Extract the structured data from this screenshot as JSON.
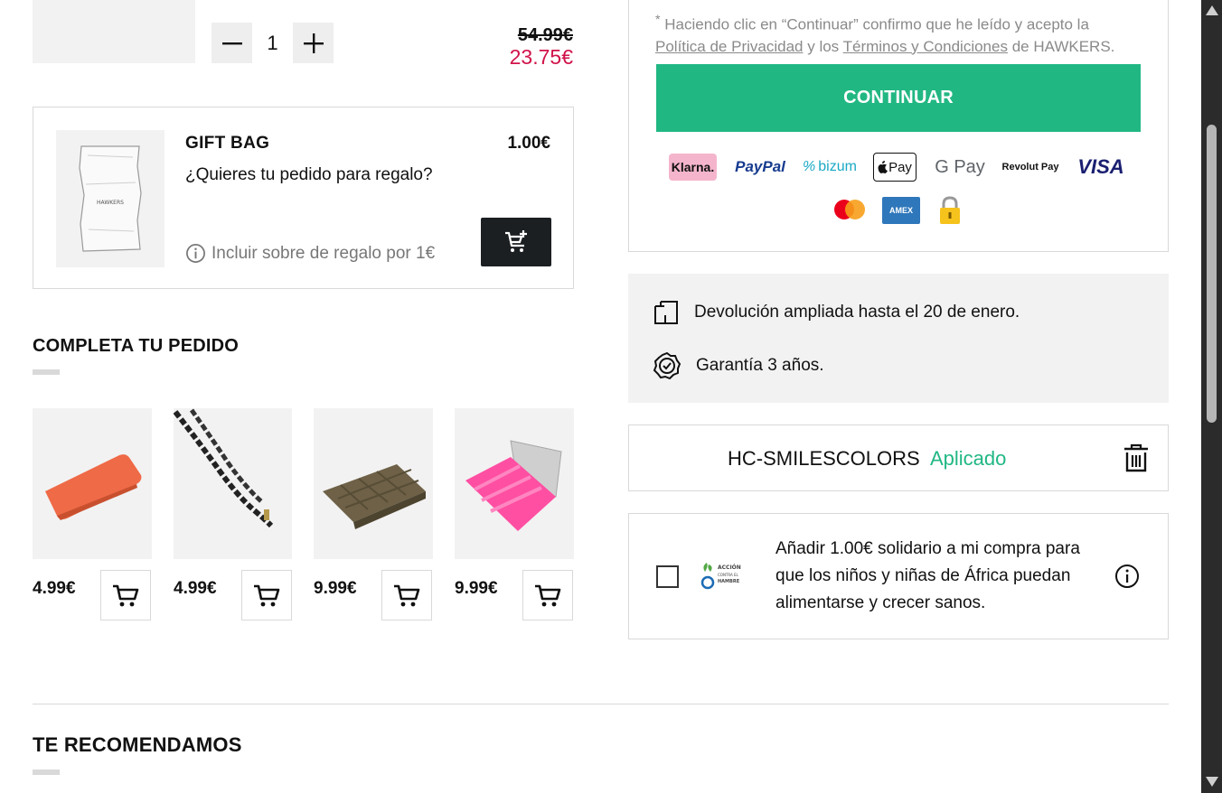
{
  "cart_item": {
    "quantity": "1",
    "old_price": "54.99€",
    "new_price": "23.75€"
  },
  "gift_bag": {
    "title": "GIFT BAG",
    "price": "1.00€",
    "description": "¿Quieres tu pedido para regalo?",
    "note": "Incluir sobre de regalo por 1€",
    "image_brand": "HAWKERS"
  },
  "complete_order": {
    "title": "COMPLETA TU PEDIDO",
    "products": [
      {
        "name": "orange-case",
        "price": "4.99€"
      },
      {
        "name": "black-chain",
        "price": "4.99€"
      },
      {
        "name": "olive-quilted-case",
        "price": "9.99€"
      },
      {
        "name": "pink-puffer-case",
        "price": "9.99€"
      }
    ]
  },
  "summary": {
    "terms_prefix": "Haciendo clic en “Continuar” confirmo que he leído y acepto la",
    "privacy_link": "Política de Privacidad",
    "terms_and": "y los",
    "terms_link": "Términos y Condiciones",
    "terms_suffix": "de HAWKERS.",
    "continue_label": "CONTINUAR",
    "payment_methods": [
      "Klarna.",
      "PayPal",
      "bizum",
      "Pay",
      "G Pay",
      "Revolut Pay",
      "VISA",
      "Mastercard",
      "AMEX",
      "secure"
    ]
  },
  "benefits": {
    "returns": "Devolución ampliada hasta el 20 de enero.",
    "warranty": "Garantía 3 años."
  },
  "coupon": {
    "code": "HC-SMILESCOLORS",
    "status": "Aplicado"
  },
  "donation": {
    "text": "Añadir 1.00€ solidario a mi compra para que los niños y niñas de África puedan alimentarse y crecer sanos.",
    "logo_text": "ACCIÓN CONTRA EL HAMBRE"
  },
  "recommend": {
    "title": "TE RECOMENDAMOS"
  },
  "colors": {
    "accent_green": "#21b783",
    "sale_red": "#d1124a",
    "dark": "#1c1f22"
  }
}
